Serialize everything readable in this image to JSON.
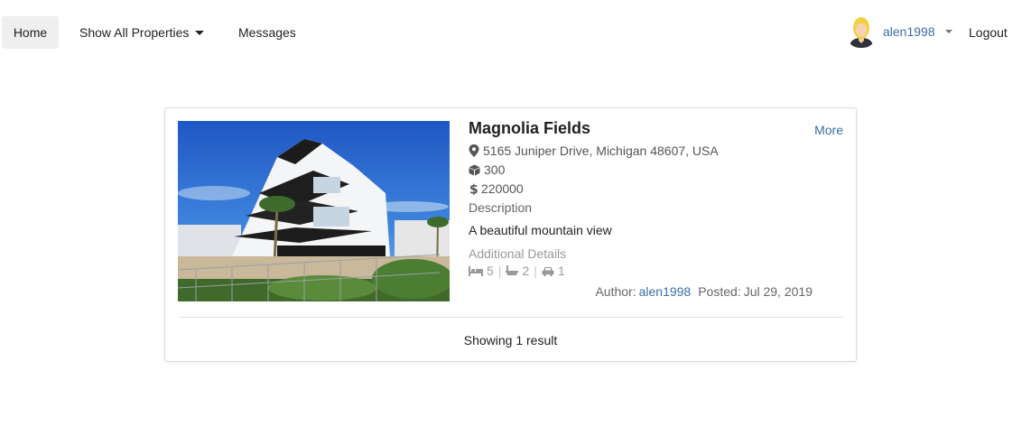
{
  "nav": {
    "home": "Home",
    "all_properties": "Show All Properties",
    "messages": "Messages",
    "username": "alen1998",
    "logout": "Logout"
  },
  "listing": {
    "title": "Magnolia Fields",
    "more": "More",
    "address": "5165 Juniper Drive, Michigan 48607, USA",
    "area": "300",
    "price": "220000",
    "description_label": "Description",
    "description": "A beautiful mountain view",
    "additional_label": "Additional Details",
    "beds": "5",
    "baths": "2",
    "garages": "1",
    "author_label": "Author:",
    "author": "alen1998",
    "posted_label": "Posted:",
    "posted_date": "Jul 29, 2019"
  },
  "footer": {
    "result_text": "Showing 1 result"
  },
  "colors": {
    "link": "#3a6ea5",
    "active_tab": "#efefef",
    "muted": "#999999"
  },
  "icons": [
    "map-marker-icon",
    "cube-icon",
    "dollar-icon",
    "bed-icon",
    "bath-icon",
    "car-icon"
  ]
}
